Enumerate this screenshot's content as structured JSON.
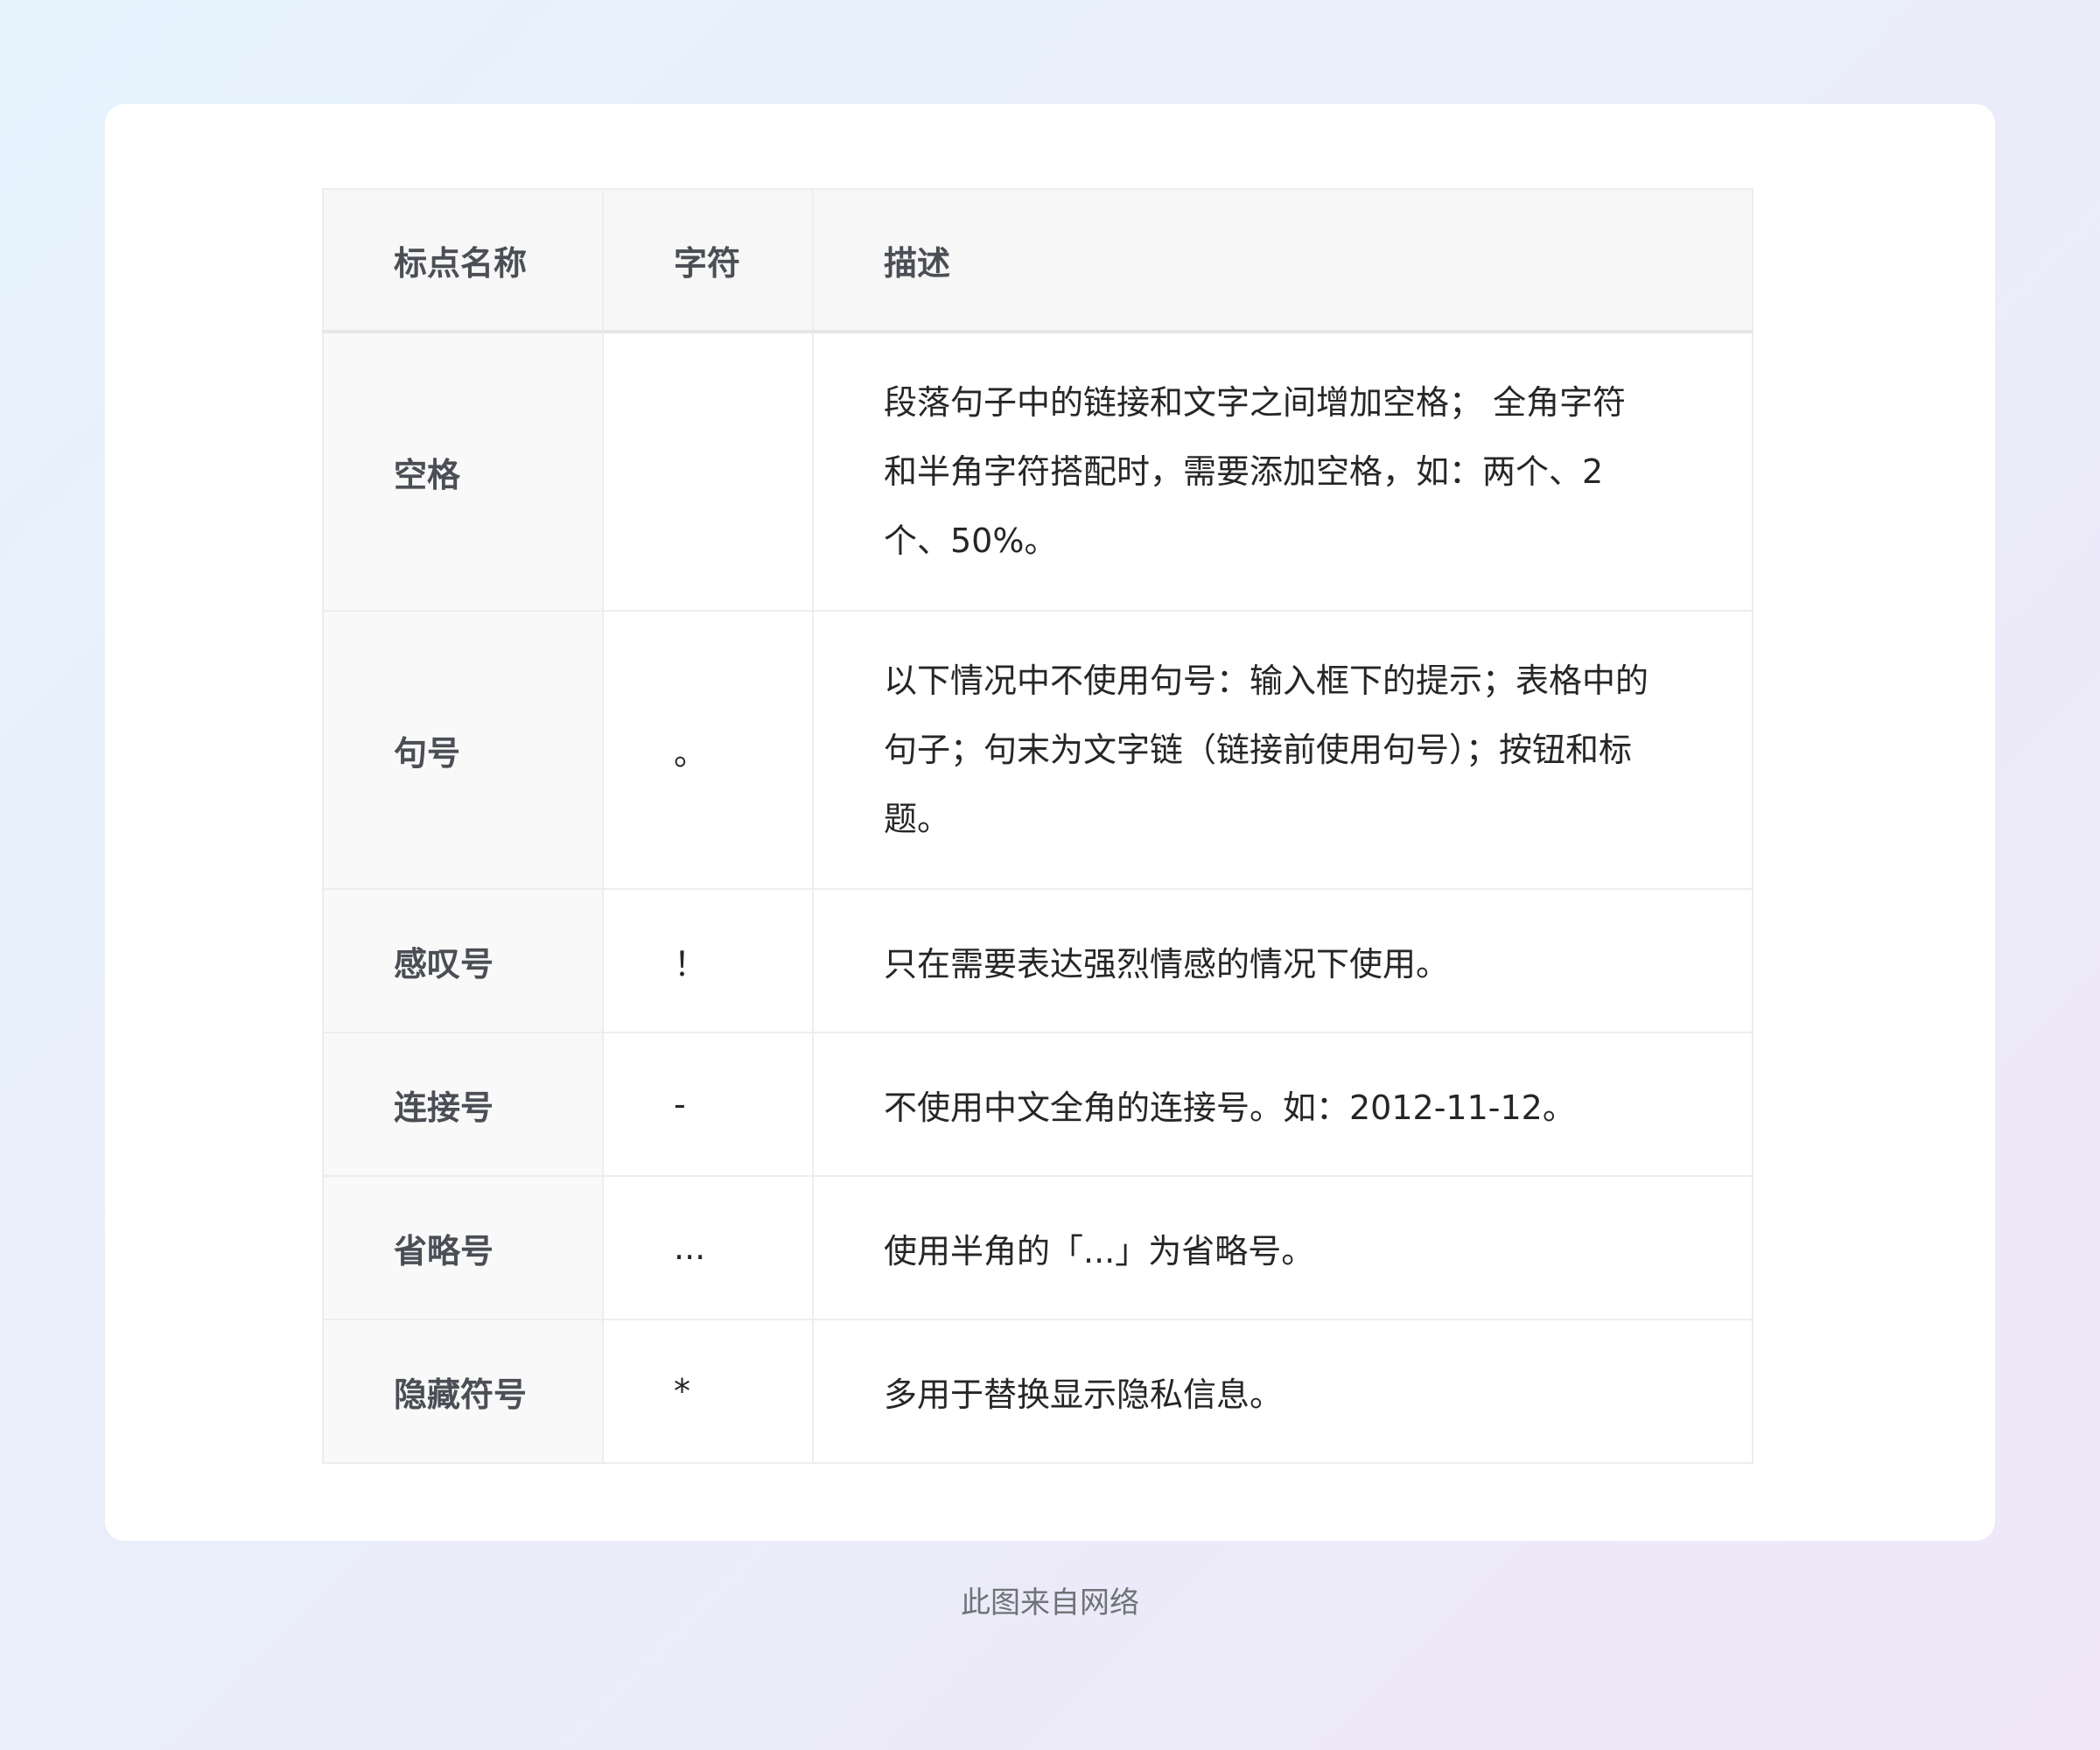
{
  "table": {
    "headers": [
      "标点名称",
      "字符",
      "描述"
    ],
    "rows": [
      {
        "name": "空格",
        "char": "",
        "desc_lines": [
          "段落句子中的链接和文字之间增加空格； 全角字符",
          "和半角字符搭配时，需要添加空格，如：两个、2",
          "个、50%。"
        ]
      },
      {
        "name": "句号",
        "char": "。",
        "desc_lines": [
          "以下情况中不使用句号：输入框下的提示；表格中的",
          "句子；句末为文字链（链接前使用句号）；按钮和标",
          "题。"
        ]
      },
      {
        "name": "感叹号",
        "char": "！",
        "desc_lines": [
          "只在需要表达强烈情感的情况下使用。"
        ]
      },
      {
        "name": "连接号",
        "char": "-",
        "desc_lines": [
          "不使用中文全角的连接号。如：2012-11-12。"
        ]
      },
      {
        "name": "省略号",
        "char": "...",
        "desc_lines": [
          "使用半角的「...」为省略号。"
        ]
      },
      {
        "name": "隐藏符号",
        "char": "*",
        "desc_lines": [
          "多用于替换显示隐私信息。"
        ]
      }
    ]
  },
  "caption": "此图来自网络"
}
